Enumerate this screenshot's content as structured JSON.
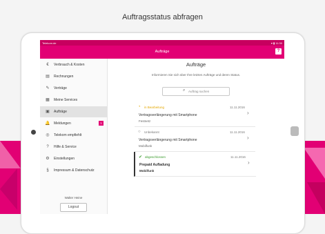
{
  "page_title": "Auftragsstatus abfragen",
  "status_bar": {
    "carrier": "Telekom.de",
    "time": "11:30"
  },
  "app_bar": {
    "title": "Aufträge",
    "help_label": "?"
  },
  "sidebar": {
    "items": [
      {
        "label": "Verbrauch & Kosten",
        "icon": "€"
      },
      {
        "label": "Rechnungen",
        "icon": "▤"
      },
      {
        "label": "Verträge",
        "icon": "✎"
      },
      {
        "label": "Meine Services",
        "icon": "▦"
      },
      {
        "label": "Aufträge",
        "icon": "▣"
      },
      {
        "label": "Meldungen",
        "icon": "🔔",
        "badge": "1"
      },
      {
        "label": "Telekom empfiehlt",
        "icon": "◎"
      },
      {
        "label": "Hilfe & Service",
        "icon": "?"
      },
      {
        "label": "Einstellungen",
        "icon": "⚙"
      },
      {
        "label": "Impressum & Datenschutz",
        "icon": "§"
      }
    ],
    "user_name": "Walter Heine",
    "logout_label": "Logout"
  },
  "main": {
    "title": "Aufträge",
    "subtitle": "Informieren Sie sich über Ihre letzten Aufträge und deren Status.",
    "search_placeholder": "Auftrag suchen",
    "orders": [
      {
        "status": "in Bearbeitung",
        "status_icon": "◔",
        "status_color": "#e3a700",
        "date": "11.11.2016",
        "title": "Vertragsverlängerung mit Smartphone",
        "subtitle": "Festnetz"
      },
      {
        "status": "Unbekannt",
        "status_icon": "○",
        "status_color": "#777777",
        "date": "11.11.2016",
        "title": "Vertragsverlängerung mit Smartphone",
        "subtitle": "Mobilfunk"
      },
      {
        "status": "abgeschlossen",
        "status_icon": "✔",
        "status_color": "#3a9b2c",
        "date": "11.11.2016",
        "title": "Prepaid Aufladung",
        "subtitle": "Mobilfunk"
      }
    ]
  },
  "colors": {
    "brand": "#e20074"
  }
}
